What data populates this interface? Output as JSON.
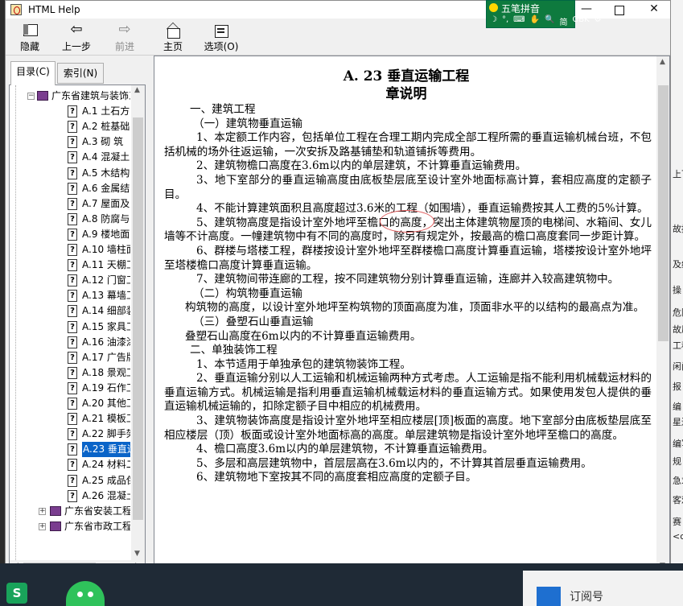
{
  "window": {
    "title": "HTML Help",
    "controls": {
      "minimize": "—",
      "maximize": "",
      "close": "✕"
    }
  },
  "ime": {
    "label": "五笔拼音",
    "row": [
      "☽",
      "°,",
      "⌨",
      "✋",
      "🔍",
      "简",
      "GBK",
      "⚙"
    ]
  },
  "toolbar": {
    "hide": "隐藏",
    "back": "上一步",
    "forward": "前进",
    "home": "主页",
    "options": "选项(O)"
  },
  "nav": {
    "tabs": [
      "目录(C)",
      "索引(N)"
    ],
    "parent": "广东省建筑与装饰工程",
    "items": [
      "A.1  土石方",
      "A.2  桩基础",
      "A.3  砌  筑",
      "A.4  混凝土",
      "A.5  木结构",
      "A.6  金属结",
      "A.7  屋面及防",
      "A.8  防腐与",
      "A.9  楼地面",
      "A.10  墙柱面",
      "A.11  天棚工",
      "A.12  门窗工",
      "A.13  幕墙工",
      "A.14  细部装",
      "A.15  家具工",
      "A.16  油漆涂",
      "A.17  广告牌",
      "A.18  景观工",
      "A.19  石作工",
      "A.20  其他工",
      "A.21  模板工",
      "A.22  脚手架",
      "A.23  垂直运",
      "A.24  材料二",
      "A.25  成品保",
      "A.26  混凝土"
    ],
    "selected_index": 22,
    "books": [
      "广东省安装工程",
      "广东省市政工程"
    ]
  },
  "document": {
    "title": "A. 23   垂直运输工程",
    "subtitle": "章说明",
    "lines": [
      {
        "cls": "sec",
        "text": "一、建筑工程"
      },
      {
        "cls": "sub",
        "text": "（一）建筑物垂直运输"
      },
      {
        "cls": "ind",
        "text": "1、本定额工作内容，包括单位工程在合理工期内完成全部工程所需的垂直运输机械台班，不包括机械的场外往返运输，一次安拆及路基铺垫和轨道铺拆等费用。"
      },
      {
        "cls": "ind",
        "text": "2、建筑物檐口高度在3.6m以内的单层建筑，不计算垂直运输费用。"
      },
      {
        "cls": "ind",
        "text": "3、地下室部分的垂直运输高度由底板垫层底至设计室外地面标高计算，套相应高度的定额子目。"
      },
      {
        "cls": "ind",
        "text": "4、不能计算建筑面积且高度超过3.6米的工程（如围墙），垂直运输费按其人工费的5%计算。"
      },
      {
        "cls": "ind",
        "text": "5、建筑物高度是指设计室外地坪至檐口的高度，突出主体建筑物屋顶的电梯间、水箱间、女儿墙等不计高度。一幢建筑物中有不同的高度时，除另有规定外，按最高的檐口高度套同一步距计算。"
      },
      {
        "cls": "ind",
        "text": "6、群楼与塔楼工程，群楼按设计室外地坪至群楼檐口高度计算垂直运输，塔楼按设计室外地坪至塔楼檐口高度计算垂直运输。"
      },
      {
        "cls": "ind",
        "text": "7、建筑物间带连廊的工程，按不同建筑物分别计算垂直运输，连廊并入较高建筑物中。"
      },
      {
        "cls": "sub",
        "text": "（二）构筑物垂直运输"
      },
      {
        "cls": "ind2",
        "text": "构筑物的高度，以设计室外地坪至构筑物的顶面高度为准，顶面非水平的以结构的最高点为准。"
      },
      {
        "cls": "sub",
        "text": "（三）叠塑石山垂直运输"
      },
      {
        "cls": "ind2",
        "text": "叠塑石山高度在6m以内的不计算垂直运输费用。"
      },
      {
        "cls": "sec",
        "text": "二、单独装饰工程"
      },
      {
        "cls": "ind",
        "text": "1、本节适用于单独承包的建筑物装饰工程。"
      },
      {
        "cls": "ind",
        "text": "2、垂直运输分别以人工运输和机械运输两种方式考虑。人工运输是指不能利用机械载运材料的垂直运输方式。机械运输是指利用垂直运输机械载运材料的垂直运输方式。如果使用发包人提供的垂直运输机械运输的，扣除定额子目中相应的机械费用。"
      },
      {
        "cls": "ind",
        "text": "3、建筑物装饰高度是指设计室外地坪至相应楼层[顶]板面的高度。地下室部分由底板垫层底至相应楼层（顶）板面或设计室外地面标高的高度。单层建筑物是指设计室外地坪至檐口的高度。"
      },
      {
        "cls": "ind",
        "text": "4、檐口高度3.6m以内的单层建筑物，不计算垂直运输费用。"
      },
      {
        "cls": "ind",
        "text": "5、多层和高层建筑物中，首层层高在3.6m以内的，不计算其首层垂直运输费用。"
      },
      {
        "cls": "ind",
        "text": "6、建筑物地下室按其不同的高度套相应高度的定额子目。"
      }
    ]
  },
  "desktop": {
    "right_fragments": [
      "上下",
      "故据",
      "及约",
      "操",
      "危险",
      "故原",
      "工程",
      "闲门",
      "报",
      "编",
      "星边",
      "编写",
      "规",
      "急求",
      "客观",
      "赛",
      "<c"
    ],
    "taskbar_subscription": "订阅号"
  }
}
